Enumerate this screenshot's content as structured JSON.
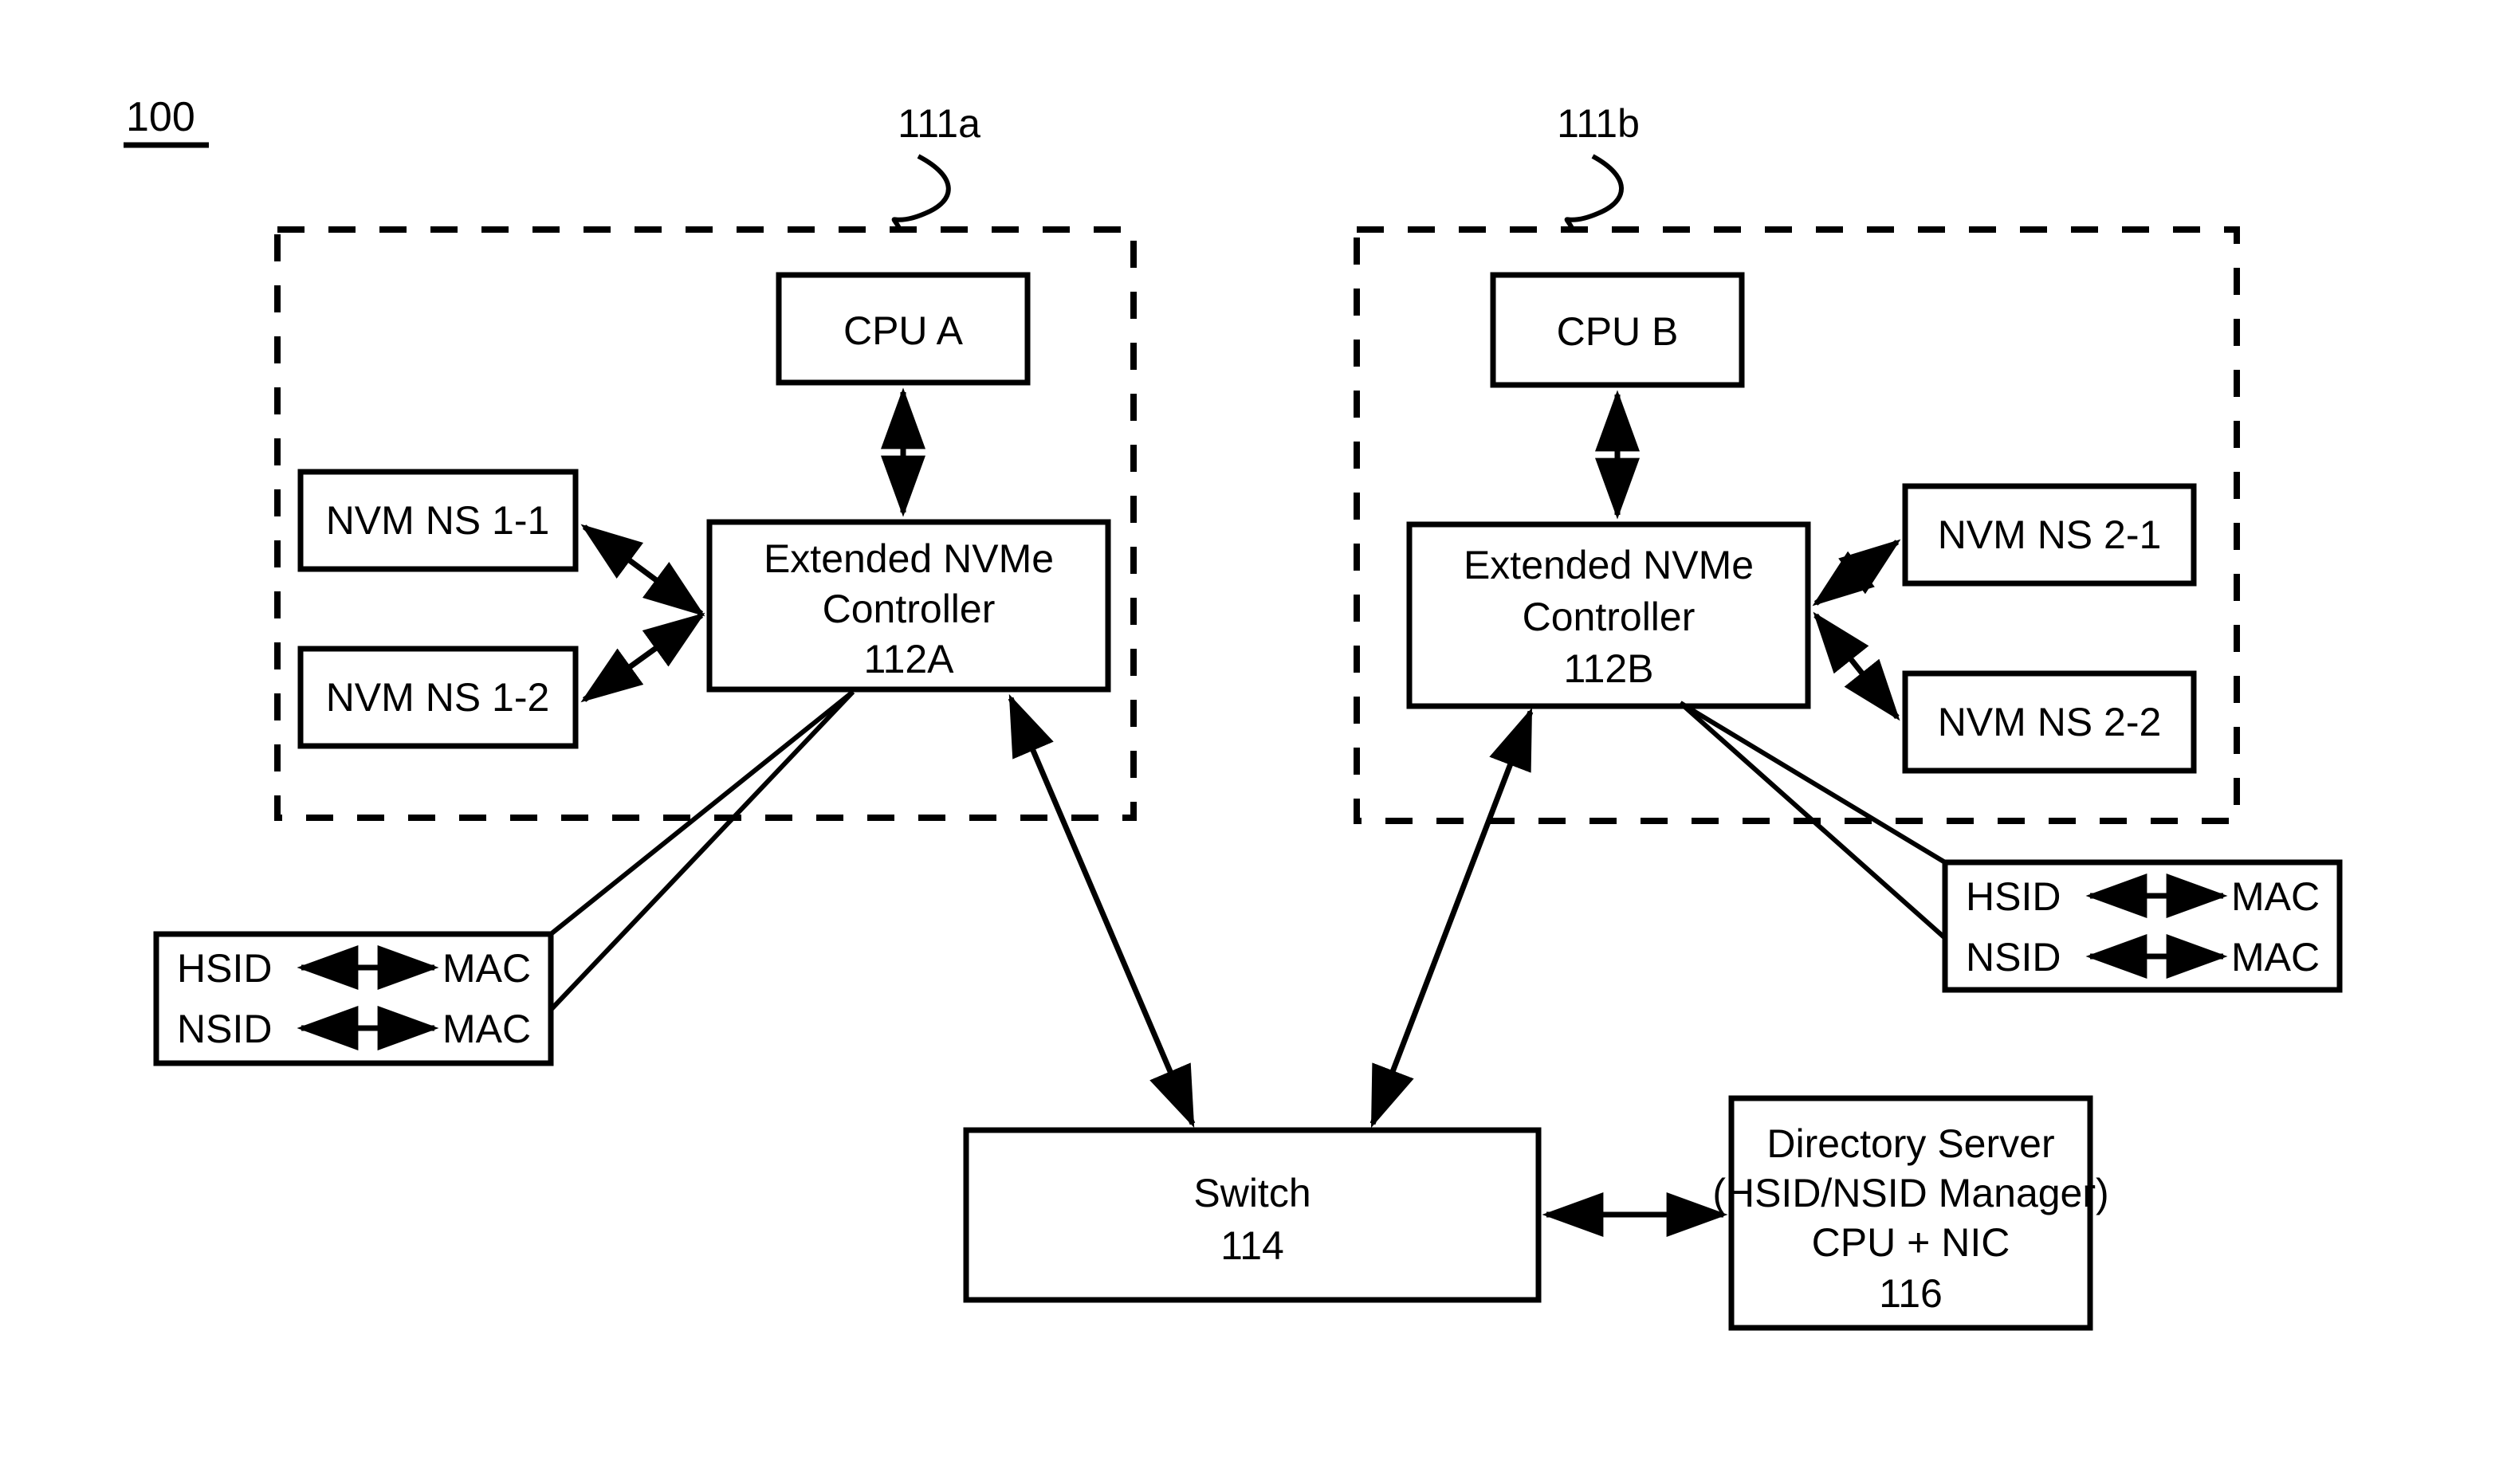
{
  "figure": {
    "number": "100"
  },
  "enclosures": [
    {
      "id": "111a",
      "label": "111a"
    },
    {
      "id": "111b",
      "label": "111b"
    }
  ],
  "boxes": {
    "cpu_a": {
      "label": "CPU A"
    },
    "cpu_b": {
      "label": "CPU B"
    },
    "controller_a": {
      "line1": "Extended NVMe",
      "line2": "Controller",
      "line3": "112A"
    },
    "controller_b": {
      "line1": "Extended NVMe",
      "line2": "Controller",
      "line3": "112B"
    },
    "nvm_ns_1_1": {
      "label": "NVM NS 1-1"
    },
    "nvm_ns_1_2": {
      "label": "NVM NS 1-2"
    },
    "nvm_ns_2_1": {
      "label": "NVM NS 2-1"
    },
    "nvm_ns_2_2": {
      "label": "NVM NS 2-2"
    },
    "switch": {
      "line1": "Switch",
      "line2": "114"
    },
    "directory_server": {
      "line1": "Directory Server",
      "line2": "(HSID/NSID Manager)",
      "line3": "CPU + NIC",
      "line4": "116"
    }
  },
  "mapping_tables": {
    "left": {
      "rows": [
        {
          "left": "HSID",
          "right": "MAC"
        },
        {
          "left": "NSID",
          "right": "MAC"
        }
      ]
    },
    "right": {
      "rows": [
        {
          "left": "HSID",
          "right": "MAC"
        },
        {
          "left": "NSID",
          "right": "MAC"
        }
      ]
    }
  },
  "colors": {
    "stroke": "#000000",
    "background": "#ffffff",
    "fill": "#ffffff"
  }
}
